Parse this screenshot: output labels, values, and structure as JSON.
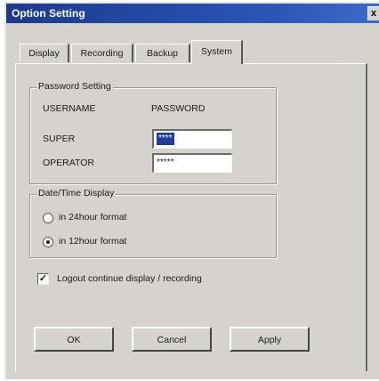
{
  "window": {
    "title": "Option Setting",
    "close_glyph": "x"
  },
  "tabs": [
    {
      "label": "Display",
      "active": false
    },
    {
      "label": "Recording",
      "active": false
    },
    {
      "label": "Backup",
      "active": false
    },
    {
      "label": "System",
      "active": true
    }
  ],
  "password_setting": {
    "legend": "Password Setting",
    "username_header": "USERNAME",
    "password_header": "PASSWORD",
    "super_label": "SUPER",
    "super_value": "****",
    "operator_label": "OPERATOR",
    "operator_value": "*****"
  },
  "datetime_display": {
    "legend": "Date/Time Display",
    "options": [
      {
        "label": "in 24hour format",
        "selected": false
      },
      {
        "label": "in 12hour format",
        "selected": true
      }
    ]
  },
  "logout_option": {
    "label": "Logout continue display / recording",
    "checked": true,
    "check_glyph": "✓"
  },
  "buttons": {
    "ok": "OK",
    "cancel": "Cancel",
    "apply": "Apply"
  },
  "colors": {
    "titlebar": "#1c3a8c",
    "face": "#d6d3ce",
    "selection": "#1f3c96"
  }
}
